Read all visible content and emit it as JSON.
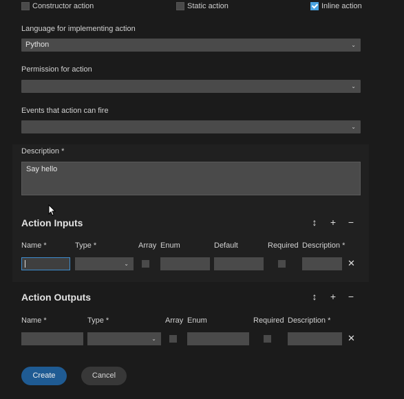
{
  "options": {
    "constructor_label": "Constructor action",
    "static_label": "Static action",
    "inline_label": "Inline action"
  },
  "language": {
    "label": "Language for implementing action",
    "value": "Python"
  },
  "permission": {
    "label": "Permission for action",
    "value": ""
  },
  "events": {
    "label": "Events that action can fire",
    "value": ""
  },
  "description": {
    "label": "Description *",
    "value": "Say hello"
  },
  "inputs": {
    "title": "Action Inputs",
    "columns": {
      "name": "Name *",
      "type": "Type *",
      "array": "Array",
      "enum": "Enum",
      "default": "Default",
      "required": "Required",
      "description": "Description *"
    }
  },
  "outputs": {
    "title": "Action Outputs",
    "columns": {
      "name": "Name *",
      "type": "Type *",
      "array": "Array",
      "enum": "Enum",
      "required": "Required",
      "description": "Description *"
    }
  },
  "buttons": {
    "create": "Create",
    "cancel": "Cancel"
  },
  "icons": {
    "sort": "↕",
    "add": "+",
    "remove": "−",
    "delete": "✕",
    "caret": "⌄"
  }
}
